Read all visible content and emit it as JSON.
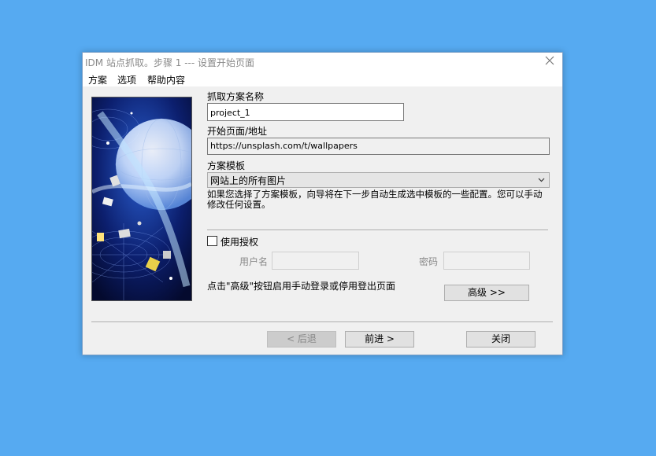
{
  "window": {
    "title": "IDM 站点抓取。步骤 1 --- 设置开始页面",
    "close_icon": "close-icon"
  },
  "menu": [
    "方案",
    "选项",
    "帮助内容"
  ],
  "form": {
    "project_name_label": "抓取方案名称",
    "project_name_value": "project_1",
    "start_page_label": "开始页面/地址",
    "start_page_value": "https://unsplash.com/t/wallpapers",
    "template_label": "方案模板",
    "template_value": "网站上的所有图片",
    "template_hint": "如果您选择了方案模板，向导将在下一步自动生成选中模板的一些配置。您可以手动修改任何设置。",
    "use_auth_label": "使用授权",
    "use_auth_checked": false,
    "username_label": "用户名",
    "username_value": "",
    "password_label": "密码",
    "password_value": "",
    "advanced_hint": "点击\"高级\"按钮启用手动登录或停用登出页面",
    "advanced_button": "高级 >>"
  },
  "buttons": {
    "back": "< 后退",
    "next": "前进 >",
    "close": "关闭"
  },
  "colors": {
    "desktop": "#56aaf1",
    "dialog_bg": "#f0f0f0"
  }
}
